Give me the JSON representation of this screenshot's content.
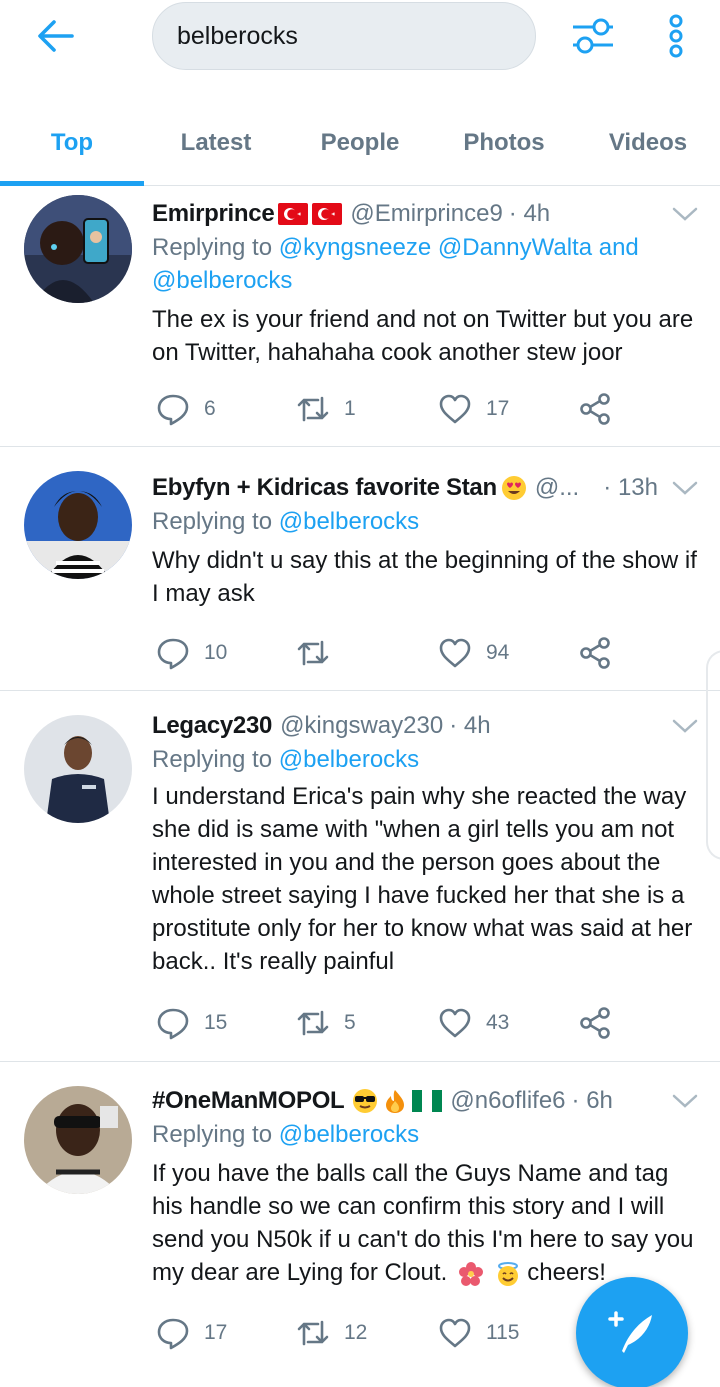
{
  "search": {
    "query": "belberocks"
  },
  "tabs": [
    {
      "label": "Top",
      "active": true
    },
    {
      "label": "Latest",
      "active": false
    },
    {
      "label": "People",
      "active": false
    },
    {
      "label": "Photos",
      "active": false
    },
    {
      "label": "Videos",
      "active": false
    }
  ],
  "colors": {
    "accent": "#1da1f2",
    "secondary_text": "#657786",
    "divider": "#dfe4e8"
  },
  "tweets": [
    {
      "name": "Emirprince",
      "name_flags": [
        "turkey-flag",
        "turkey-flag"
      ],
      "handle": "@Emirprince9",
      "time": "· 4h",
      "reply_prefix": "Replying to",
      "reply_to": "@kyngsneeze @DannyWalta and @belberocks",
      "text": "The ex is your friend and not on Twitter but you are on Twitter, hahahaha cook another stew joor",
      "replies": "6",
      "retweets": "1",
      "likes": "17"
    },
    {
      "name": "Ebyfyn + Kidricas favorite Stan",
      "name_emoji": [
        "heart-eyes-emoji"
      ],
      "handle": "@...",
      "time": "· 13h",
      "reply_prefix": "Replying to",
      "reply_to": "@belberocks",
      "text": "Why didn't u say this at the beginning of the show if I may ask",
      "replies": "10",
      "retweets": "",
      "likes": "94"
    },
    {
      "name": "Legacy230",
      "handle": "@kingsway230",
      "time": "· 4h",
      "reply_prefix": "Replying to",
      "reply_to": "@belberocks",
      "text": "I understand Erica's pain why she reacted the way she did is same with \"when a girl tells you am not interested in you and the person goes about the whole street saying I have fucked her that she is a prostitute only for her to know what was said at her back.. It's really painful",
      "replies": "15",
      "retweets": "5",
      "likes": "43"
    },
    {
      "name": "#OneManMOPOL",
      "name_emoji": [
        "sunglasses-emoji",
        "fire-emoji",
        "nigeria-flag"
      ],
      "handle": "@n6oflife6",
      "time": "· 6h",
      "reply_prefix": "Replying to",
      "reply_to": "@belberocks",
      "text": "If you have the balls call the Guys Name and tag his handle so we can confirm this story and I will send you N50k if u can't do this I'm here to say you my dear are Lying for Clout.",
      "text_tail": "cheers!",
      "replies": "17",
      "retweets": "12",
      "likes": "115"
    }
  ]
}
